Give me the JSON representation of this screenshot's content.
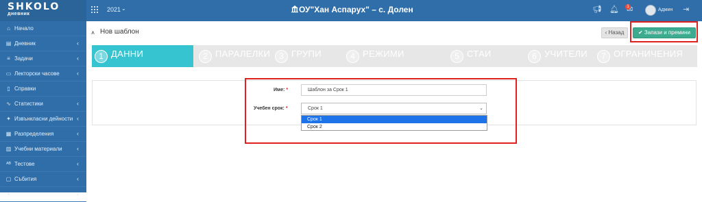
{
  "app": {
    "logo": "SHKOLO",
    "logo_sub": "дневник",
    "year": "2021",
    "school": "ОУ\"Хан Аспарух\" – с. Долен",
    "notification_count": "1",
    "username": "Админ"
  },
  "sidebar": {
    "items": [
      {
        "label": "Начало",
        "icon": "home-icon",
        "glyph": "⌂",
        "has_children": false
      },
      {
        "label": "Дневник",
        "icon": "diary-icon",
        "glyph": "▤",
        "has_children": true
      },
      {
        "label": "Задачи",
        "icon": "tasks-icon",
        "glyph": "≡",
        "has_children": true
      },
      {
        "label": "Лекторски часове",
        "icon": "lecture-hours-icon",
        "glyph": "▭",
        "has_children": true
      },
      {
        "label": "Справки",
        "icon": "reports-icon",
        "glyph": "▯",
        "has_children": false
      },
      {
        "label": "Статистики",
        "icon": "statistics-icon",
        "glyph": "∿",
        "has_children": true
      },
      {
        "label": "Извънкласни дейности",
        "icon": "extracurricular-icon",
        "glyph": "✦",
        "has_children": true
      },
      {
        "label": "Разпределения",
        "icon": "distributions-icon",
        "glyph": "▦",
        "has_children": true
      },
      {
        "label": "Учебни материали",
        "icon": "materials-icon",
        "glyph": "▥",
        "has_children": true
      },
      {
        "label": "Тестове",
        "icon": "tests-icon",
        "glyph": "ᴬᴮ",
        "has_children": true
      },
      {
        "label": "Събития",
        "icon": "events-icon",
        "glyph": "▢",
        "has_children": true
      },
      {
        "label": "",
        "icon": "more-icon",
        "glyph": "•",
        "has_children": true
      }
    ]
  },
  "page": {
    "title": "Нов шаблон",
    "back_label": "Назад",
    "save_label": "Запази и премини"
  },
  "wizard": {
    "steps": [
      {
        "num": "1",
        "label": "ДАННИ",
        "active": true
      },
      {
        "num": "2",
        "label": "ПАРАЛЕЛКИ",
        "active": false
      },
      {
        "num": "3",
        "label": "ГРУПИ",
        "active": false
      },
      {
        "num": "4",
        "label": "РЕЖИМИ",
        "active": false
      },
      {
        "num": "5",
        "label": "СТАИ",
        "active": false
      },
      {
        "num": "6",
        "label": "УЧИТЕЛИ",
        "active": false
      },
      {
        "num": "7",
        "label": "ОГРАНИЧЕНИЯ",
        "active": false
      }
    ]
  },
  "form": {
    "name_label": "Име:",
    "name_value": "Шаблон за Срок 1",
    "term_label": "Учебен срок:",
    "term_value": "Срок 1",
    "term_options": [
      "Срок 1",
      "Срок 2"
    ],
    "required_mark": "*"
  },
  "colors": {
    "topbar": "#2f6ea9",
    "active_step": "#36c4d1",
    "save_button": "#3cab8f",
    "highlight": "#e0201c",
    "selected_option": "#1e73e8"
  }
}
